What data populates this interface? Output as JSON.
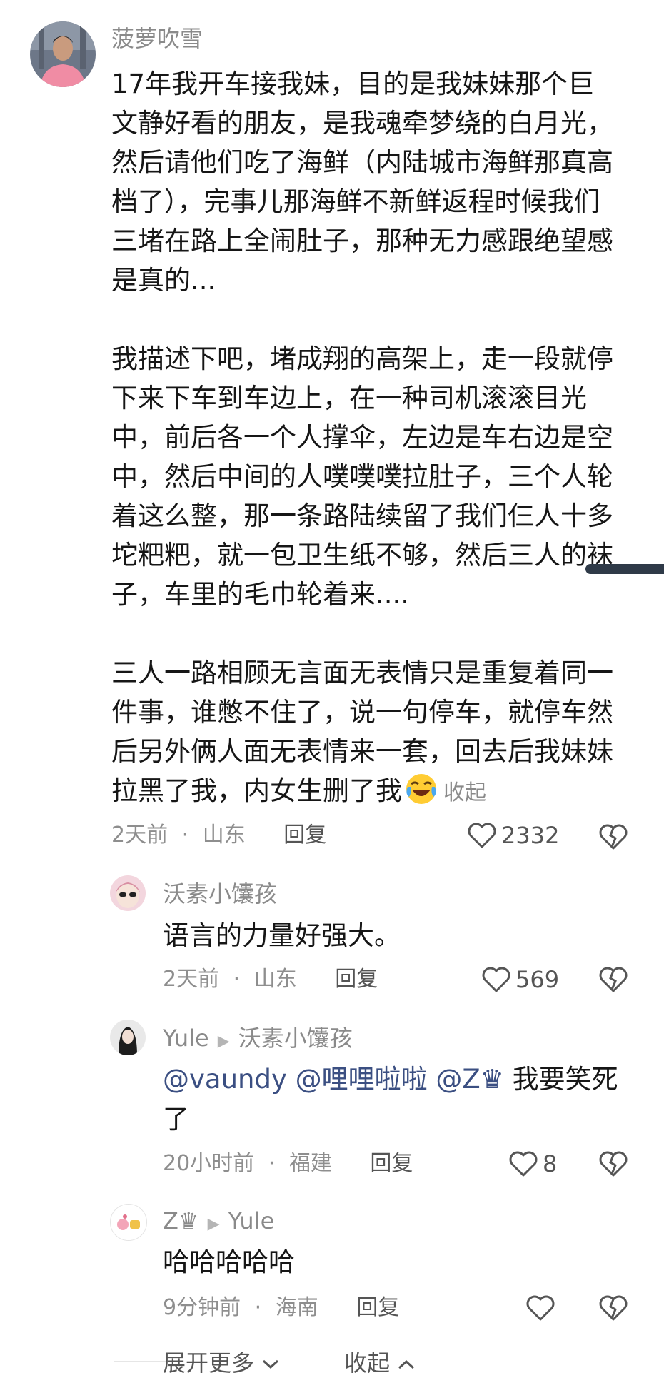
{
  "main_comment": {
    "author": "菠萝吹雪",
    "paragraphs": [
      [
        "17年我开车接我妹，目的是我妹妹那个巨",
        "文静好看的朋友，是我魂牵梦绕的白月光，",
        "然后请他们吃了海鲜（内陆城市海鲜那真高",
        "档了），完事儿那海鲜不新鲜返程时候我们",
        "三堵在路上全闹肚子，那种无力感跟绝望感",
        "是真的..."
      ],
      [
        "我描述下吧，堵成翔的高架上，走一段就停",
        "下来下车到车边上，在一种司机滚滚目光",
        "中，前后各一个人撑伞，左边是车右边是空",
        "中，然后中间的人噗噗噗拉肚子，三个人轮",
        "着这么整，那一条路陆续留了我们仨人十多",
        "坨粑粑，就一包卫生纸不够，然后三人的袜",
        "子，车里的毛巾轮着来...."
      ],
      [
        "三人一路相顾无言面无表情只是重复着同一",
        "件事，谁憋不住了，说一句停车，就停车然",
        "后另外俩人面无表情来一套，回去后我妹妹"
      ]
    ],
    "last_line": "拉黑了我，内女生删了我",
    "collapse_label": "收起",
    "time": "2天前",
    "location": "山东",
    "reply_label": "回复",
    "likes": "2332"
  },
  "replies": [
    {
      "author": "沃素小馕孩",
      "reply_to": "",
      "text_lines": [
        "语言的力量好强大。"
      ],
      "time": "2天前",
      "location": "山东",
      "reply_label": "回复",
      "likes": "569"
    },
    {
      "author": "Yule",
      "reply_to": "沃素小馕孩",
      "mentions": "@vaundy @哩哩啦啦 @Z♛",
      "text_after_mentions": " 我要笑死",
      "text_line2": "了",
      "time": "20小时前",
      "location": "福建",
      "reply_label": "回复",
      "likes": "8"
    },
    {
      "author": "Z♛",
      "reply_to": "Yule",
      "text_lines": [
        "哈哈哈哈哈"
      ],
      "time": "9分钟前",
      "location": "海南",
      "reply_label": "回复",
      "likes": ""
    }
  ],
  "footer": {
    "expand_label": "展开更多",
    "collapse_label": "收起"
  },
  "separator": "·",
  "colors": {
    "text": "#161616",
    "muted": "#8a8a8a",
    "mention": "#3b4f82"
  }
}
